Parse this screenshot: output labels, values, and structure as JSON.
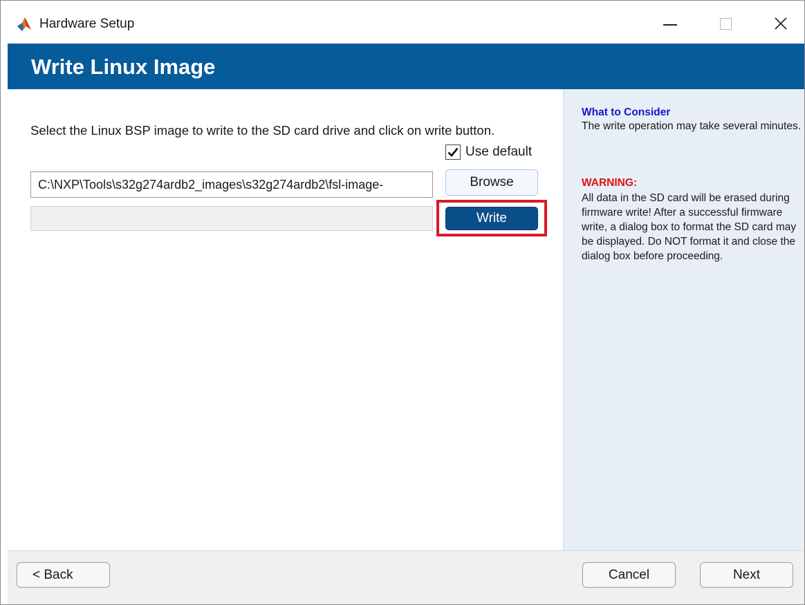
{
  "window": {
    "title": "Hardware Setup",
    "app_icon": "matlab-icon",
    "controls": [
      "minimize-icon",
      "maximize-icon",
      "close-icon"
    ],
    "close_glyph": "✕"
  },
  "header": {
    "title": "Write Linux Image",
    "background_color": "#065b9b"
  },
  "main": {
    "instruction": "Select the Linux BSP image to write to the SD card drive and click on write button.",
    "use_default": {
      "label": "Use default",
      "checked": true,
      "check_glyph": "✔"
    },
    "image_path": "C:\\NXP\\Tools\\s32g274ardb2_images\\s32g274ardb2\\fsl-image-",
    "browse_label": "Browse",
    "write_label": "Write",
    "progress": 0
  },
  "side_panel": {
    "consider_title": "What to Consider",
    "consider_text": "The write operation may take several minutes.",
    "warning_title": "WARNING:",
    "warning_text": "All data in the SD card will be erased during firmware write! After a successful firmware write, a dialog box to format the SD card may be displayed. Do NOT format it and close the dialog box before proceeding.",
    "consider_color": "#1717c9",
    "warning_color": "#e01313"
  },
  "footer": {
    "back_label": "< Back",
    "cancel_label": "Cancel",
    "next_label": "Next"
  },
  "highlight_color": "#d81b2a"
}
